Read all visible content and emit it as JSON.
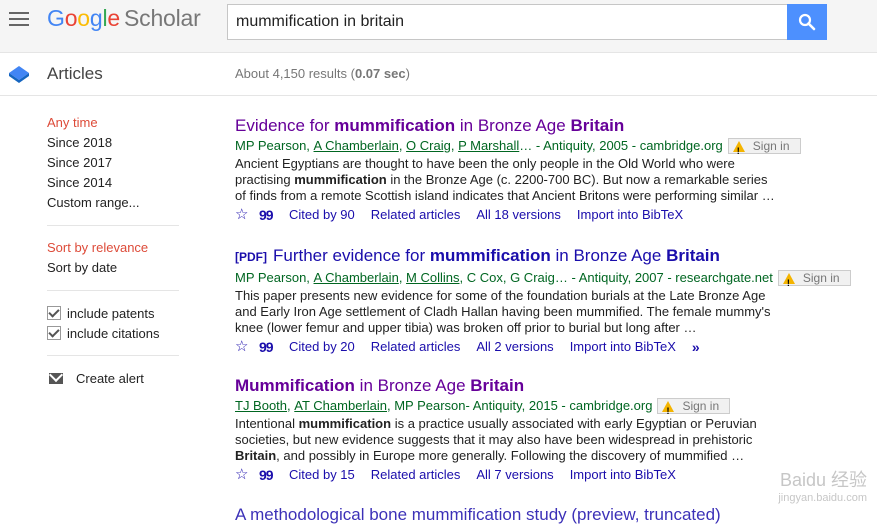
{
  "header": {
    "logo_google": [
      "G",
      "o",
      "o",
      "g",
      "l",
      "e"
    ],
    "logo_scholar": "Scholar",
    "search_value": "mummification in britain"
  },
  "subheader": {
    "section": "Articles",
    "results_prefix": "About 4,150 results (",
    "results_time": "0.07 sec",
    "results_suffix": ")"
  },
  "sidebar": {
    "time_filters": [
      "Any time",
      "Since 2018",
      "Since 2017",
      "Since 2014",
      "Custom range..."
    ],
    "sort": [
      "Sort by relevance",
      "Sort by date"
    ],
    "checks": [
      "include patents",
      "include citations"
    ],
    "alert": "Create alert"
  },
  "results": [
    {
      "title_pre": "Evidence for ",
      "title_b1": "mummification",
      "title_mid": " in Bronze Age ",
      "title_b2": "Britain",
      "authors": [
        "MP Pearson",
        "A Chamberlain",
        "O Craig",
        "P Marshall"
      ],
      "source": "… - Antiquity, 2005 - cambridge.org",
      "signin": "Sign in",
      "snippet_1": "Ancient Egyptians are thought to have been the only people in the Old World who were practising ",
      "snippet_b": "mummification",
      "snippet_2": " in the Bronze Age (c. 2200-700 BC). But now a remarkable series of finds from a remote Scottish island indicates that Ancient Britons were performing similar …",
      "cited": "Cited by 90",
      "related": "Related articles",
      "versions": "All 18 versions",
      "import": "Import into BibTeX"
    },
    {
      "pdf": "[PDF]",
      "title_pre": "Further evidence for ",
      "title_b1": "mummification",
      "title_mid": " in Bronze Age ",
      "title_b2": "Britain",
      "authors": [
        "MP Pearson",
        "A Chamberlain",
        "M Collins"
      ],
      "authors_plain": ", C Cox, G Craig",
      "source": "… - Antiquity, 2007 - researchgate.net",
      "signin": "Sign in",
      "snippet": "This paper presents new evidence for some of the foundation burials at the Late Bronze Age and Early Iron Age settlement of Cladh Hallan having been mummified. The female mummy's knee (lower femur and upper tibia) was broken off prior to burial but long after …",
      "cited": "Cited by 20",
      "related": "Related articles",
      "versions": "All 2 versions",
      "import": "Import into BibTeX",
      "more": "»"
    },
    {
      "title_b1": "Mummification",
      "title_mid": " in Bronze Age ",
      "title_b2": "Britain",
      "authors": [
        "TJ Booth",
        "AT Chamberlain"
      ],
      "authors_plain": ", MP Pearson",
      "source": " - Antiquity, 2015 - cambridge.org",
      "signin": "Sign in",
      "snippet_1": "Intentional ",
      "snippet_b": "mummification",
      "snippet_2": " is a practice usually associated with early Egyptian or Peruvian societies, but new evidence suggests that it may also have been widespread in prehistoric ",
      "snippet_b2": "Britain",
      "snippet_3": ", and possibly in Europe more generally. Following the discovery of mummified …",
      "cited": "Cited by 15",
      "related": "Related articles",
      "versions": "All 7 versions",
      "import": "Import into BibTeX"
    }
  ],
  "partial_title": "A methodological bone mummification study (preview, truncated)",
  "watermark": {
    "line1": "Baidu 经验",
    "line2": "jingyan.baidu.com"
  },
  "colors": {
    "accent_blue": "#4d90fe",
    "active_red": "#dd4b39",
    "link_blue": "#1a0dab",
    "visited_purple": "#660099",
    "source_green": "#006621"
  }
}
